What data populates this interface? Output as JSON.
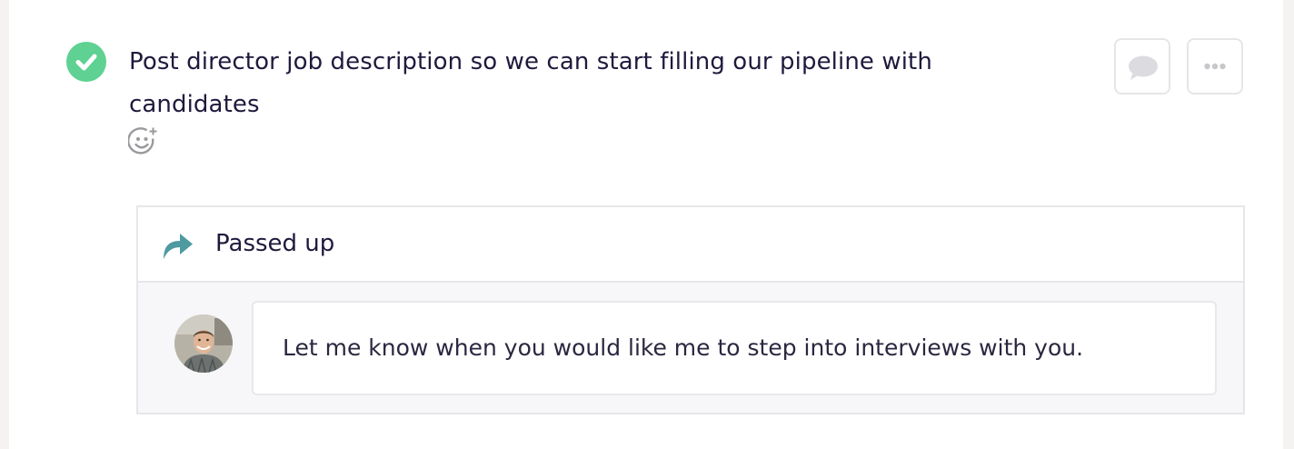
{
  "task": {
    "status_icon": "check-circle-icon",
    "title": "Post director job description so we can start filling our pipeline with candidates",
    "reaction_icon": "add-emoji-icon"
  },
  "actions": {
    "comment_icon": "speech-bubble-icon",
    "more_icon": "ellipsis-icon"
  },
  "passed_up": {
    "icon": "share-arrow-icon",
    "label": "Passed up",
    "avatar_icon": "user-avatar",
    "message": "Let me know when you would like me to step into interviews with you."
  },
  "colors": {
    "check_green": "#5fd192",
    "arrow_teal": "#4e9aa0",
    "text_dark": "#1f1a3d"
  }
}
